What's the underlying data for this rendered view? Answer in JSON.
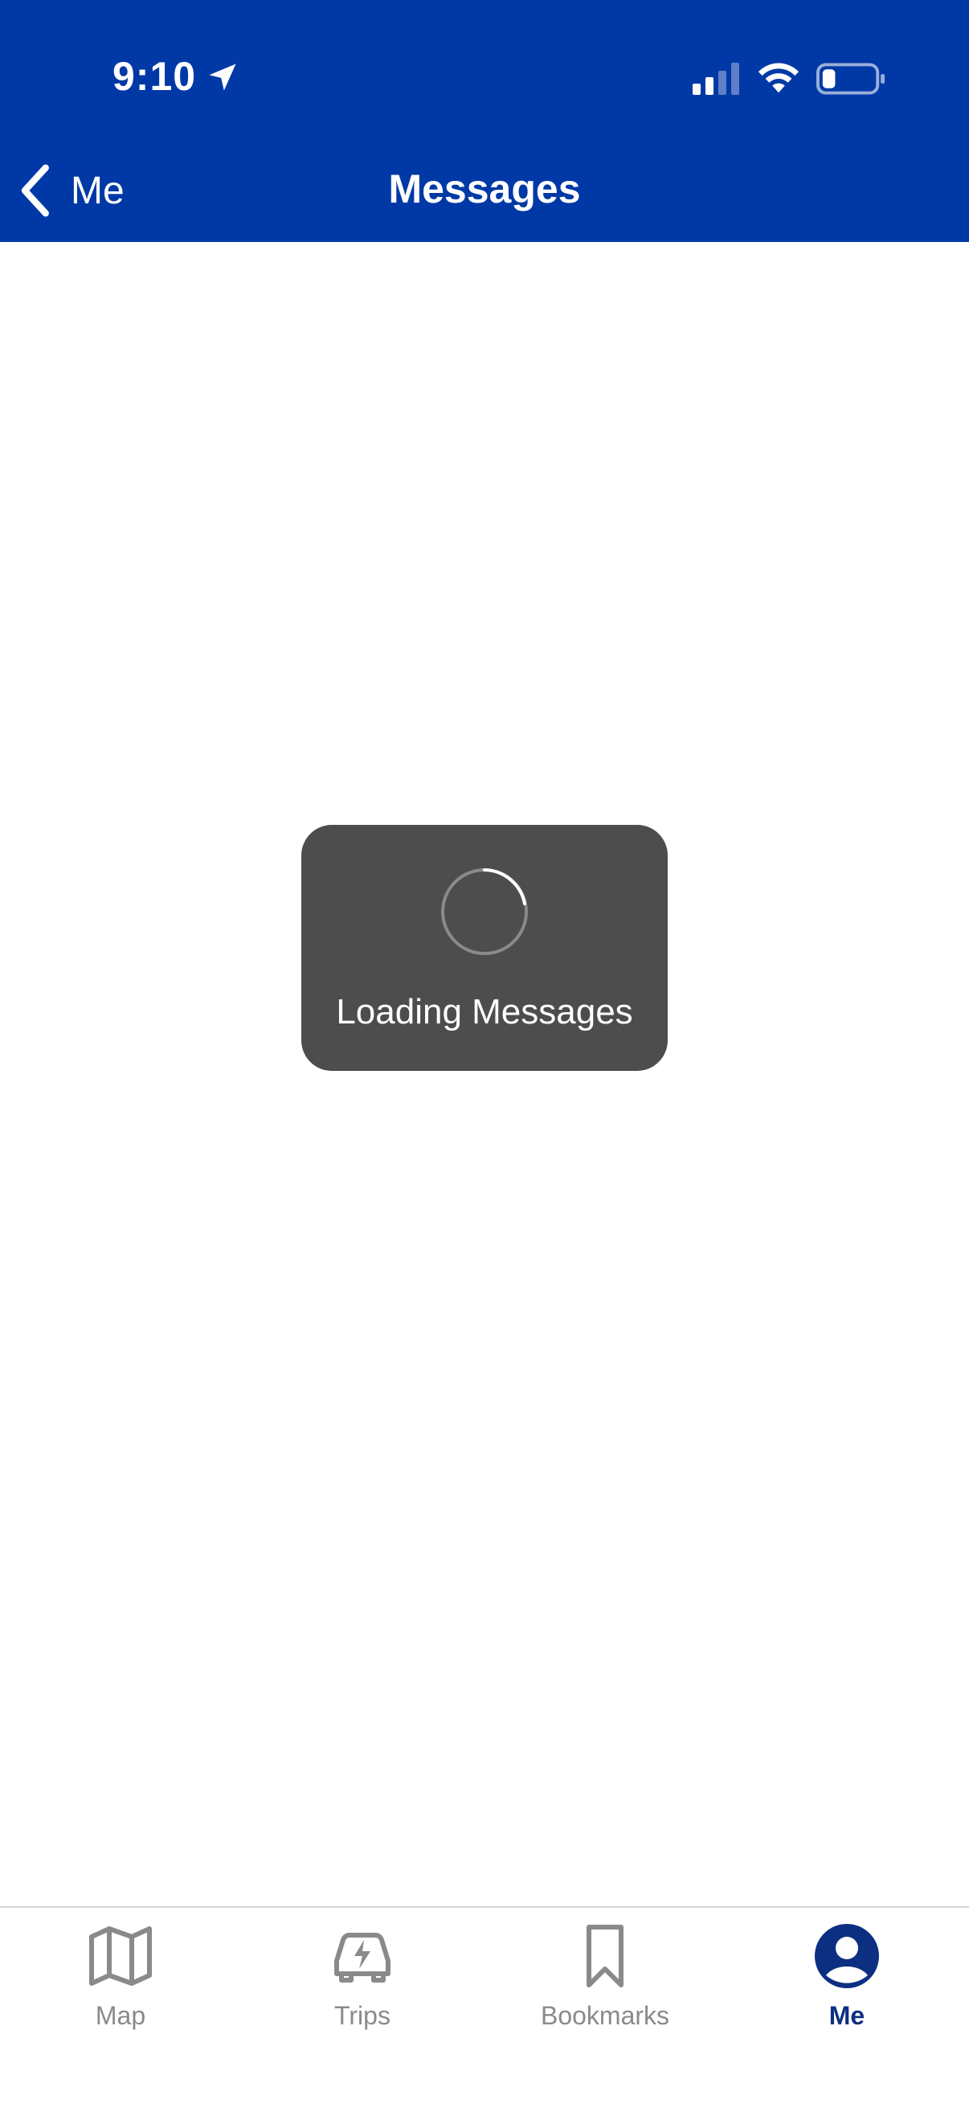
{
  "status_bar": {
    "time": "9:10"
  },
  "nav": {
    "back_label": "Me",
    "title": "Messages"
  },
  "loading": {
    "label": "Loading Messages"
  },
  "tabs": [
    {
      "label": "Map",
      "icon": "map-icon"
    },
    {
      "label": "Trips",
      "icon": "ev-car-icon"
    },
    {
      "label": "Bookmarks",
      "icon": "bookmark-icon"
    },
    {
      "label": "Me",
      "icon": "profile-icon",
      "active": true
    }
  ],
  "colors": {
    "header_bg": "#0039a6",
    "hud_bg": "#4d4d4d",
    "tab_inactive": "#8a8a8a",
    "tab_active": "#0d2f82"
  }
}
